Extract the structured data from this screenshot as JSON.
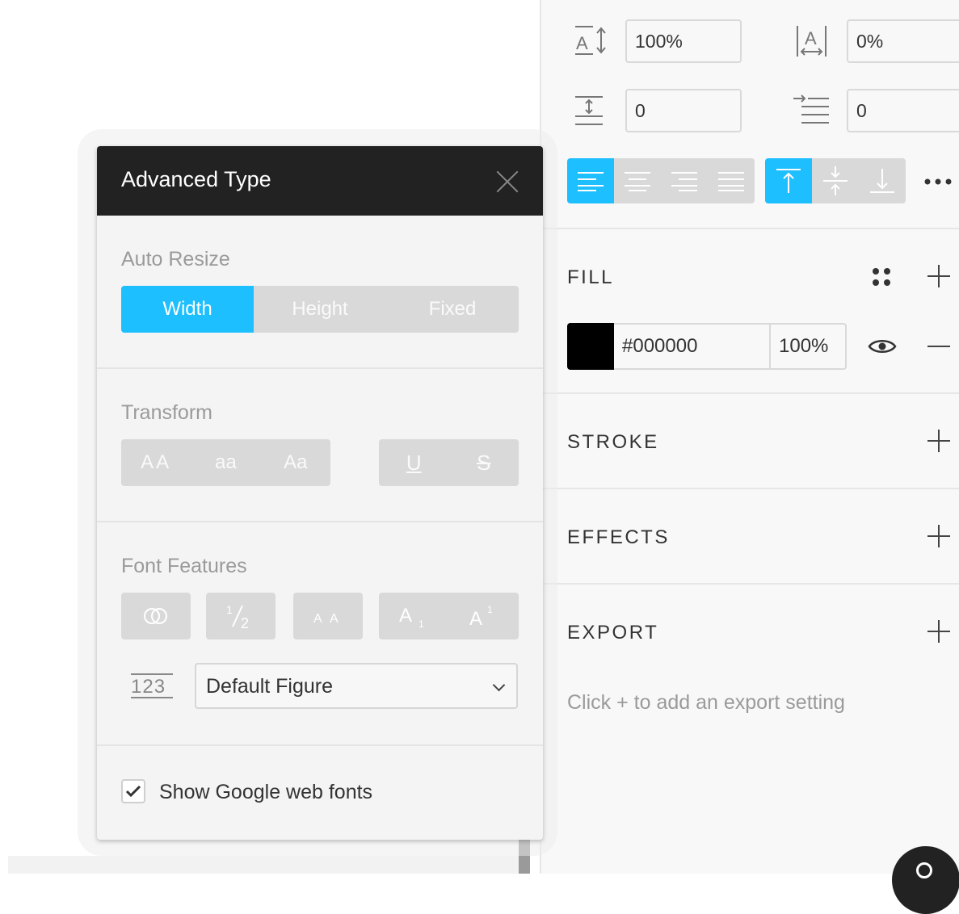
{
  "typography": {
    "line_height_value": "100%",
    "letter_spacing_value": "0%",
    "paragraph_spacing_value": "0",
    "paragraph_indent_value": "0"
  },
  "fill": {
    "title": "FILL",
    "color_hex": "#000000",
    "swatch_color": "#000000",
    "opacity": "100%"
  },
  "stroke": {
    "title": "STROKE"
  },
  "effects": {
    "title": "EFFECTS"
  },
  "export": {
    "title": "EXPORT",
    "hint": "Click + to add an export setting"
  },
  "advanced_type": {
    "title": "Advanced Type",
    "auto_resize": {
      "label": "Auto Resize",
      "options": [
        "Width",
        "Height",
        "Fixed"
      ],
      "selected": "Width"
    },
    "transform": {
      "label": "Transform",
      "case_options": [
        "AA",
        "aa",
        "Aa"
      ],
      "decoration_options": [
        "U",
        "S"
      ]
    },
    "font_features": {
      "label": "Font Features",
      "figure_select": "Default Figure",
      "figure_icon_text": "123"
    },
    "show_google_fonts": {
      "label": "Show Google web fonts",
      "checked": true
    }
  },
  "colors": {
    "accent": "#1ebfff",
    "popup_header": "#222222"
  }
}
